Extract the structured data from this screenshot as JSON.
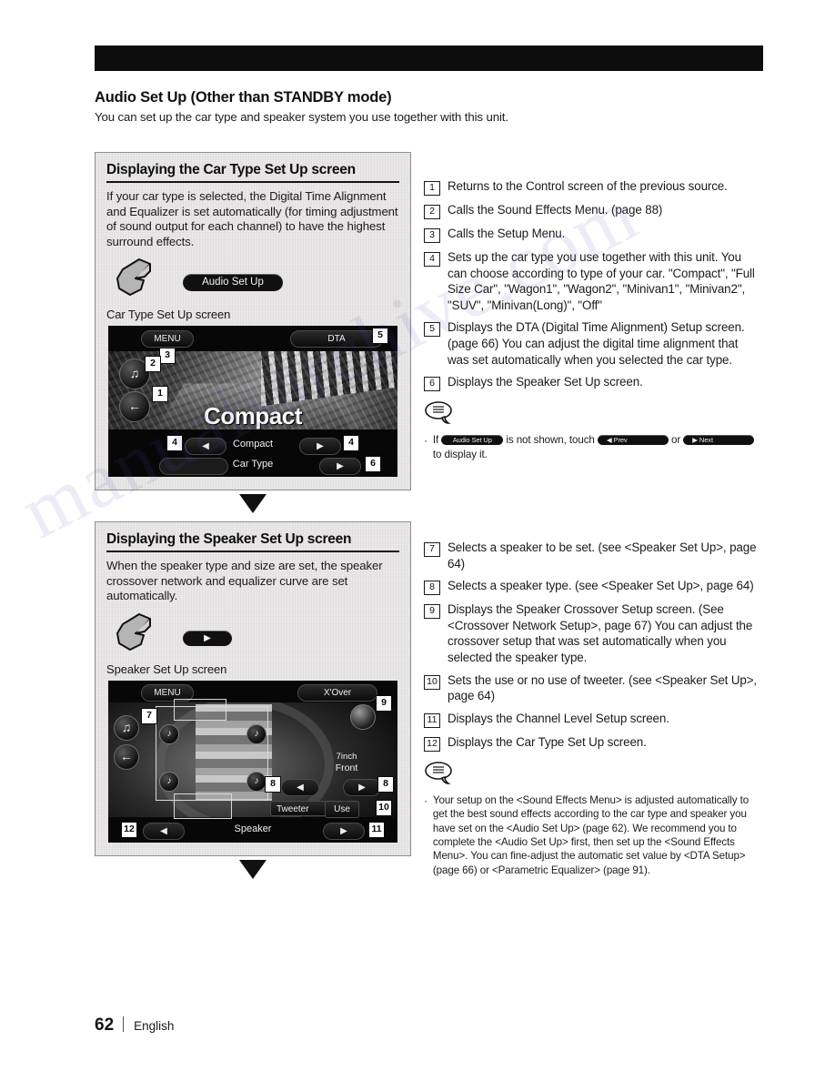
{
  "document": {
    "title": "Audio Set Up (Other than STANDBY mode)",
    "subtitle": "You can set up the car type and speaker system you use together with this unit."
  },
  "sections": [
    {
      "heading": "Displaying the Car Type Set Up screen",
      "body": "If your car type is selected, the Digital Time Alignment and Equalizer is set automatically (for timing adjustment of sound output for each channel) to have the highest surround effects.",
      "action_button": "Audio Set Up",
      "screen_caption": "Car Type Set Up screen",
      "screen": {
        "menu_button": "MENU",
        "dta_button": "DTA",
        "title_overlay": "Compact",
        "value_label": "Compact",
        "bottom_label": "Car Type",
        "left_arrow": "◀",
        "right_arrow": "▶",
        "badges": [
          "1",
          "2",
          "3",
          "4",
          "4",
          "5",
          "6"
        ]
      }
    },
    {
      "heading": "Displaying the Speaker Set Up screen",
      "body": "When the speaker type and size are set, the speaker crossover network and equalizer curve are set automatically.",
      "action_button": "▶",
      "screen_caption": "Speaker Set Up screen",
      "screen": {
        "menu_button": "MENU",
        "xover_button": "X'Over",
        "size_label": "7inch",
        "position_label": "Front",
        "tweeter_label": "Tweeter",
        "tweeter_value": "Use",
        "bottom_label": "Speaker",
        "left_arrow": "◀",
        "right_arrow": "▶",
        "badges": [
          "7",
          "8",
          "8",
          "9",
          "10",
          "11",
          "12"
        ]
      }
    }
  ],
  "callouts_top": [
    {
      "num": "1",
      "text": "Returns to the Control screen of the previous source."
    },
    {
      "num": "2",
      "text": "Calls the Sound Effects Menu. (page 88)"
    },
    {
      "num": "3",
      "text": "Calls the Setup Menu."
    },
    {
      "num": "4",
      "text": "Sets up the car type you use together with this unit. You can choose according to type of your car. \"Compact\", \"Full Size Car\", \"Wagon1\", \"Wagon2\", \"Minivan1\", \"Minivan2\", \"SUV\", \"Minivan(Long)\", \"Off\""
    },
    {
      "num": "5",
      "text": "Displays the DTA (Digital Time Alignment) Setup screen. (page 66) You can adjust the digital time alignment that was set automatically when you selected the car type."
    },
    {
      "num": "6",
      "text": "Displays the Speaker Set Up screen."
    }
  ],
  "note_top": {
    "bullet": "·",
    "part1": "If",
    "pill1": "Audio Set Up",
    "part2": "is not shown, touch",
    "pill2": "◀ Prev",
    "part3": "or",
    "pill3": "▶ Next",
    "part4": "to display it."
  },
  "callouts_bottom": [
    {
      "num": "7",
      "text": "Selects a speaker to be set. (see <Speaker Set Up>, page 64)"
    },
    {
      "num": "8",
      "text": "Selects a speaker type. (see <Speaker Set Up>, page 64)"
    },
    {
      "num": "9",
      "text": "Displays the Speaker Crossover Setup screen. (See <Crossover Network Setup>, page 67) You can adjust the crossover setup that was set automatically when you selected the speaker type."
    },
    {
      "num": "10",
      "text": "Sets the use or no use of tweeter. (see <Speaker Set Up>, page 64)"
    },
    {
      "num": "11",
      "text": "Displays the Channel Level Setup screen."
    },
    {
      "num": "12",
      "text": "Displays the Car Type Set Up screen."
    }
  ],
  "note_bottom": {
    "bullet": "·",
    "text": "Your setup on the <Sound Effects Menu> is adjusted automatically to get the best sound effects according to the car type and speaker you have set on the <Audio Set Up> (page 62). We recommend you to complete the <Audio Set Up> first, then set up the <Sound Effects Menu>. You can fine-adjust the automatic set value by <DTA Setup> (page 66) or <Parametric Equalizer> (page 91)."
  },
  "footer": {
    "page_number": "62",
    "language": "English"
  },
  "watermark": {
    "text": "manualsarchive.com"
  },
  "colors": {
    "ink": "#111111",
    "panel_bg": "#eceaea",
    "panel_border": "#8f8f8f",
    "screen_bg": "#0a0a0a"
  }
}
